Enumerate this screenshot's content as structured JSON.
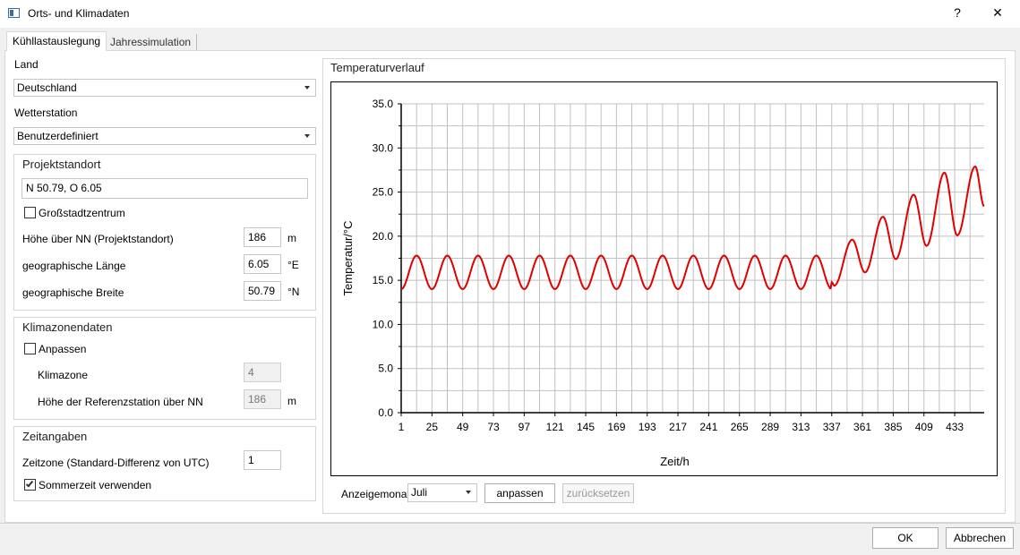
{
  "window": {
    "title": "Orts- und Klimadaten",
    "help_label": "?",
    "close_label": "✕"
  },
  "tabs": [
    {
      "label": "Kühllastauslegung",
      "active": true
    },
    {
      "label": "Jahressimulation",
      "active": false
    }
  ],
  "land": {
    "label": "Land",
    "value": "Deutschland"
  },
  "wetterstation": {
    "label": "Wetterstation",
    "value": "Benutzerdefiniert"
  },
  "projektstandort": {
    "title": "Projektstandort",
    "coords": "N 50.79, O 6.05",
    "grossstadt_label": "Großstadtzentrum",
    "grossstadt_checked": false,
    "hoehe_label": "Höhe über NN (Projektstandort)",
    "hoehe_value": "186",
    "hoehe_unit": "m",
    "laenge_label": "geographische Länge",
    "laenge_value": "6.05",
    "laenge_unit": "°E",
    "breite_label": "geographische Breite",
    "breite_value": "50.79",
    "breite_unit": "°N"
  },
  "klimazonendaten": {
    "title": "Klimazonendaten",
    "anpassen_label": "Anpassen",
    "anpassen_checked": false,
    "klimazone_label": "Klimazone",
    "klimazone_value": "4",
    "refhoehe_label": "Höhe der Referenzstation über NN",
    "refhoehe_value": "186",
    "refhoehe_unit": "m"
  },
  "zeitangaben": {
    "title": "Zeitangaben",
    "zeitzone_label": "Zeitzone (Standard-Differenz von UTC)",
    "zeitzone_value": "1",
    "sommerzeit_label": "Sommerzeit verwenden",
    "sommerzeit_checked": true
  },
  "temperaturverlauf": {
    "title": "Temperaturverlauf",
    "anzeigemonat_label": "Anzeigemonat",
    "anzeigemonat_value": "Juli",
    "anpassen_button": "anpassen",
    "zuruecksetzen_button": "zurücksetzen"
  },
  "footer": {
    "ok_label": "OK",
    "cancel_label": "Abbrechen"
  },
  "colors": {
    "series": "#e00000",
    "grid": "#c0c0c0"
  },
  "chart_data": {
    "type": "line",
    "title": "",
    "xlabel": "Zeit/h",
    "ylabel": "Temperatur/°C",
    "xlim": [
      1,
      456
    ],
    "ylim": [
      0,
      35
    ],
    "x_ticks": [
      1,
      25,
      49,
      73,
      97,
      121,
      145,
      169,
      193,
      217,
      241,
      265,
      289,
      313,
      337,
      361,
      385,
      409,
      433
    ],
    "y_ticks": [
      "0.0",
      "5.0",
      "10.0",
      "15.0",
      "20.0",
      "25.0",
      "30.0",
      "35.0"
    ],
    "grid": true,
    "series": [
      {
        "period_h": 24,
        "phase_a": {
          "x_range": [
            1,
            336
          ],
          "min": 14.0,
          "max": 17.8
        },
        "phase_b": {
          "x_range": [
            336,
            456
          ],
          "peaks": [
            {
              "x": 353,
              "y": 19.6
            },
            {
              "x": 377,
              "y": 22.2
            },
            {
              "x": 401,
              "y": 24.7
            },
            {
              "x": 425,
              "y": 27.2
            },
            {
              "x": 449,
              "y": 27.9
            }
          ],
          "troughs": [
            {
              "x": 339,
              "y": 14.4
            },
            {
              "x": 363,
              "y": 15.9
            },
            {
              "x": 387,
              "y": 17.4
            },
            {
              "x": 411,
              "y": 18.9
            },
            {
              "x": 435,
              "y": 20.1
            }
          ],
          "end": {
            "x": 456,
            "y": 23.4
          }
        }
      }
    ]
  }
}
